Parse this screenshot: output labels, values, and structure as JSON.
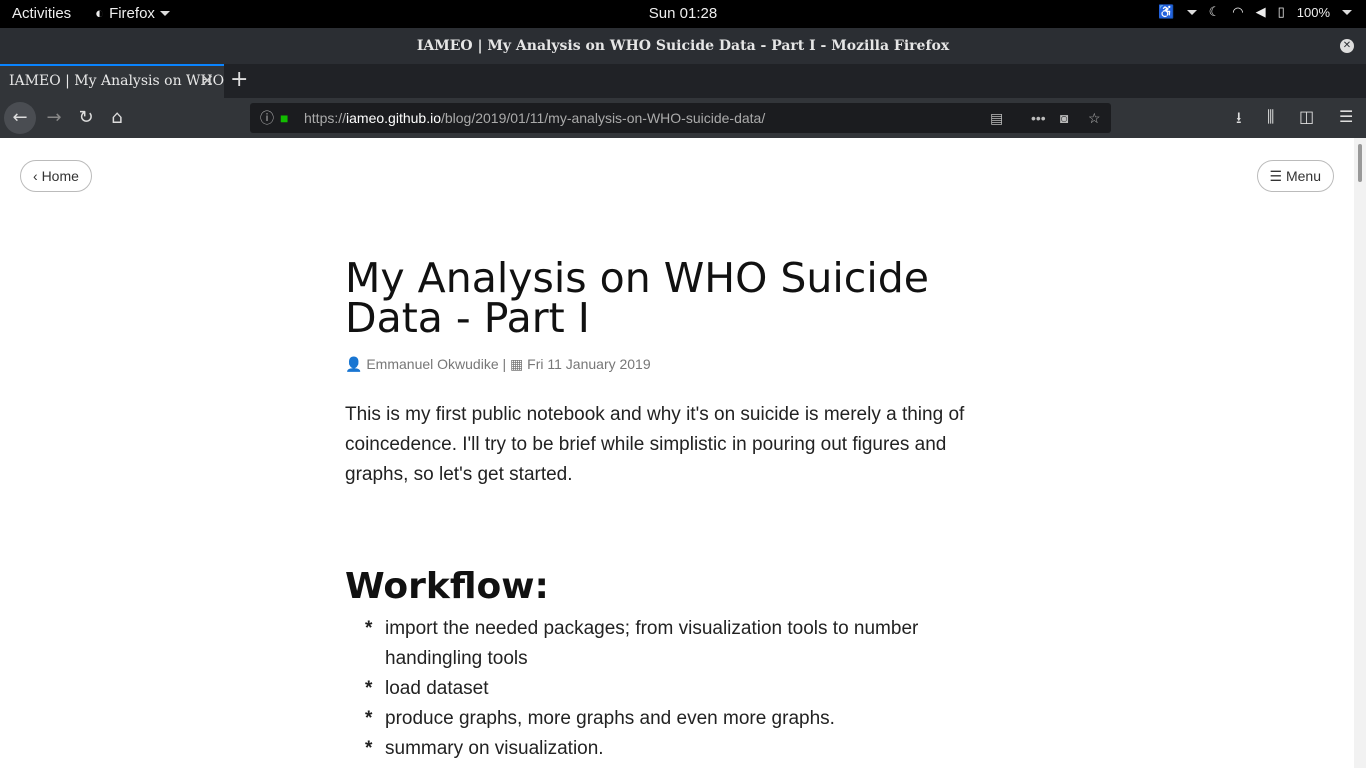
{
  "system": {
    "activities": "Activities",
    "app_name": "Firefox",
    "clock": "Sun 01:28",
    "battery": "100%"
  },
  "window": {
    "title": "IAMEO | My Analysis on WHO Suicide Data - Part I - Mozilla Firefox"
  },
  "tabs": [
    {
      "label": "IAMEO | My Analysis on WHO Suicide Data - Part I"
    }
  ],
  "toolbar": {
    "url_prefix": "https://",
    "url_host": "iameo.github.io",
    "url_path": "/blog/2019/01/11/my-analysis-on-WHO-suicide-data/"
  },
  "page": {
    "home_label": "Home",
    "menu_label": "Menu",
    "title": "My Analysis on WHO Suicide Data - Part I",
    "author": "Emmanuel Okwudike",
    "date": "Fri 11 January 2019",
    "intro": "This is my first public notebook and why it's on suicide is merely a thing of coincedence. I'll try to be brief while simplistic in pouring out figures and graphs, so let's get started.",
    "section_heading": "Workflow:",
    "workflow": [
      {
        "text": "import the needed packages; from visualization tools to number handingling tools"
      },
      {
        "text": "load dataset"
      },
      {
        "text": "produce graphs, more graphs and even more graphs."
      },
      {
        "text": "summary on visualization."
      }
    ]
  },
  "colors": {
    "accent": "#0a84ff",
    "lock": "#12bc00"
  }
}
